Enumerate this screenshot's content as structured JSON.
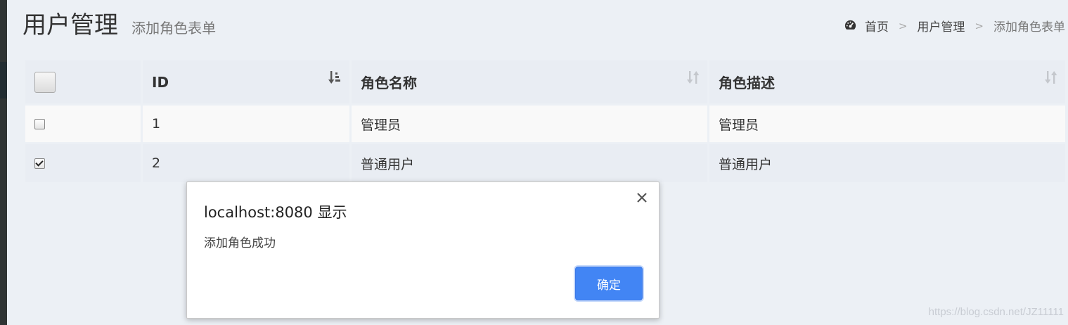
{
  "header": {
    "title": "用户管理",
    "subtitle": "添加角色表单"
  },
  "breadcrumb": {
    "home_icon": "dashboard-icon",
    "items": [
      "首页",
      "用户管理",
      "添加角色表单"
    ],
    "separator": ">"
  },
  "table": {
    "columns": [
      "",
      "ID",
      "角色名称",
      "角色描述"
    ],
    "sort_icons": [
      "sort-amount-asc-icon",
      "sort-icon",
      "sort-icon"
    ],
    "rows": [
      {
        "checked": false,
        "id": "1",
        "name": "管理员",
        "desc": "管理员"
      },
      {
        "checked": true,
        "id": "2",
        "name": "普通用户",
        "desc": "普通用户"
      }
    ]
  },
  "dialog": {
    "title": "localhost:8080 显示",
    "message": "添加角色成功",
    "ok_label": "确定",
    "close_icon": "close-icon"
  },
  "watermark": "https://blog.csdn.net/JZ11111",
  "colors": {
    "background": "#ecf0f5",
    "ok_button": "#4285f4",
    "sidebar": "#2f3434"
  }
}
